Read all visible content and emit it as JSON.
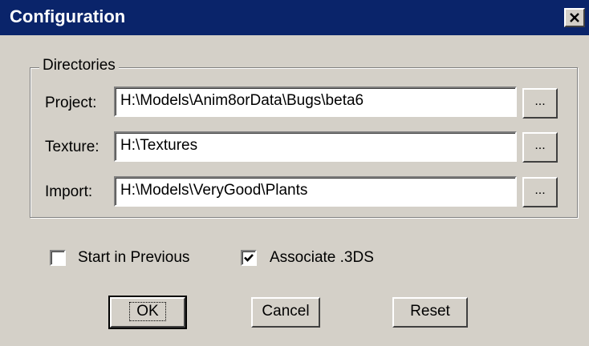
{
  "window": {
    "title": "Configuration",
    "close_icon": "close-icon"
  },
  "directories": {
    "group_label": "Directories",
    "rows": [
      {
        "label": "Project:",
        "value": "H:\\Models\\Anim8orData\\Bugs\\beta6",
        "browse_label": "..."
      },
      {
        "label": "Texture:",
        "value": "H:\\Textures",
        "browse_label": "..."
      },
      {
        "label": "Import:",
        "value": "H:\\Models\\VeryGood\\Plants",
        "browse_label": "..."
      }
    ]
  },
  "options": {
    "start_in_previous": {
      "label": "Start in Previous",
      "checked": false
    },
    "associate_3ds": {
      "label": "Associate .3DS",
      "checked": true
    }
  },
  "buttons": {
    "ok": "OK",
    "cancel": "Cancel",
    "reset": "Reset"
  },
  "colors": {
    "titlebar": "#0a246a",
    "face": "#d4d0c8"
  }
}
